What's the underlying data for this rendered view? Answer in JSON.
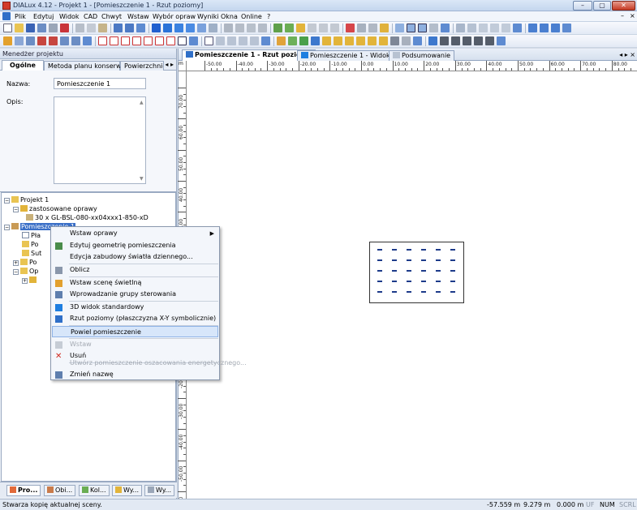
{
  "window": {
    "title": "DIALux 4.12 - Projekt 1 - [Pomieszczenie 1 - Rzut poziomy]",
    "minimize": "–",
    "maximize": "▢",
    "close": "✕"
  },
  "menubar": {
    "items": [
      "Plik",
      "Edytuj",
      "Widok",
      "CAD",
      "Chwyt",
      "Wstaw",
      "Wybór opraw",
      "Wyniki",
      "Okna",
      "Online",
      "?"
    ],
    "mdi_min": "–",
    "mdi_close": "×"
  },
  "panel": {
    "title": "Menedżer projektu",
    "tabs": [
      "Ogólne",
      "Metoda planu konserwacji",
      "Powierzchnie"
    ],
    "tab_arrows": "◂ ▸",
    "name_label": "Nazwa:",
    "name_value": "Pomieszczenie 1",
    "desc_label": "Opis:",
    "desc_value": ""
  },
  "tree": {
    "project": "Projekt 1",
    "used_luminaires": "zastosowane oprawy",
    "luminaire": "30 x GL-BSL-080-xx04xxx1-850-xD",
    "room": "Pomieszczenie 1",
    "child_1": "Pła",
    "child_2": "Po",
    "child_3": "Sut",
    "child_4": "Po",
    "child_5": "Op"
  },
  "bottom_tabs": [
    "Pro...",
    "Obi...",
    "Kol...",
    "Wy...",
    "Wy..."
  ],
  "doc_tabs": [
    "Pomieszczenie 1 - Rzut poziomy",
    "Pomieszczenie 1 - Widok 3D",
    "Podsumowanie"
  ],
  "view_ctrl": "◂ ▸ ×",
  "ruler": {
    "unit": "m",
    "h_labels": [
      "-50.00",
      "-40.00",
      "-30.00",
      "-20.00",
      "-10.00",
      "0.00",
      "10.00",
      "20.00",
      "30.00",
      "40.00",
      "50.00",
      "60.00",
      "70.00",
      "80.00"
    ],
    "v_labels": [
      "70.00",
      "60.00",
      "50.00",
      "40.00",
      "30.00",
      "20.00",
      "10.00",
      "0.00",
      "-10.00",
      "-20.00",
      "-30.00",
      "-40.00",
      "-50.00",
      "-60.00"
    ]
  },
  "context_menu": {
    "items": [
      {
        "label": "Wstaw oprawy",
        "submenu": "▶"
      },
      {
        "label": "Edytuj geometrię pomieszczenia"
      },
      {
        "label": "Edycja zabudowy światła dziennego..."
      },
      {
        "label": "Oblicz"
      },
      {
        "label": "Wstaw scenę świetlną"
      },
      {
        "label": "Wprowadzanie grupy sterowania"
      },
      {
        "label": "3D widok standardowy"
      },
      {
        "label": "Rzut poziomy (płaszczyzna X-Y symbolicznie)"
      },
      {
        "label": "Powiel pomieszczenie"
      },
      {
        "label": "Wstaw"
      },
      {
        "label": "Usuń"
      },
      {
        "label": "Utwórz pomieszczenie oszacowania energetycznego..."
      },
      {
        "label": "Zmień nazwę"
      }
    ]
  },
  "status": {
    "message": "Stwarza kopię aktualnej sceny.",
    "x": "-57.559 m",
    "y": "9.279 m",
    "z": "0.000 m",
    "uf": "UF",
    "num": "NUM",
    "scrl": "SCRL"
  },
  "colors": {
    "accent": "#3a6fc7",
    "highlight": "#d7e6fa",
    "luminaire": "#1d3b8a"
  }
}
